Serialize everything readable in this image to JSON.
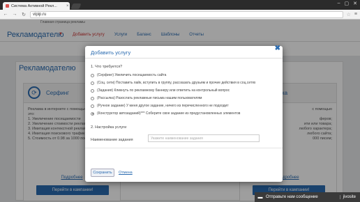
{
  "browser": {
    "tab_title": "Система Активной Рекл...",
    "tab_close": "×",
    "url": "vipip.ru",
    "back": "←",
    "forward": "→",
    "reload": "↻",
    "star": "☆",
    "menu": "≡",
    "controls": [
      "–",
      "▢",
      "✕"
    ]
  },
  "site": {
    "home_link": "Главная страница рекламы",
    "logo_title": "Рекламодателю",
    "caret": "▼",
    "nav": [
      "Добавить услугу",
      "Услуги",
      "Баланс",
      "Шаблоны",
      "Отчеты"
    ]
  },
  "panel": {
    "title": "Рекламодателю",
    "cards": [
      {
        "title": "Серфинг",
        "icon": "refresh-icon",
        "body": "Реклама в интернете с помощью\nэто:\n1. Увеличение посещаемости\n2. Увеличение стоимости рекламы\n3. Имитация контекстной реклам\n4. Имитация поискового трафика\n5. Стоимость от 0.98 за 1000 посе",
        "more": "Подробнее",
        "button": "Перейти в кампании!"
      },
      {
        "title": "Рассылка",
        "icon": "mail-icon",
        "body": "с помощью\n\nферов;\nити или товара;\nлюбого характера;\nлюбого сайта;\n000 писем;",
        "more": "Подробнее",
        "button": "Перейти в кампании!"
      }
    ]
  },
  "modal": {
    "title": "Добавить услугу",
    "close": "✖",
    "section1": "1. Что требуется?",
    "options": [
      {
        "label": "(Серфинг) Увеличить посещаемость сайта",
        "checked": false
      },
      {
        "label": "(Соц. сети) Поставить лайк, вступить в группу, рассказать друзьям и прочие действия в соц.сетях",
        "checked": false
      },
      {
        "label": "(Задания) Кликнуть по рекламному баннеру или ответить на контрольный вопрос",
        "checked": false
      },
      {
        "label": "(Рассылка) Разослать рекламные письма нашим пользователям",
        "checked": false
      },
      {
        "label": "(Ручное задание) У меня другое задание, ничего из перечисленного не подходит",
        "checked": false
      },
      {
        "label": "(Конструктор автозаданий)*** Соберите свое задание из предустановленных элементов",
        "checked": true
      }
    ],
    "section2": "2. Настройка услуги",
    "field_label": "Наименование задания",
    "field_placeholder": "Укажите наименование задания",
    "field_value": "",
    "save_label": "Сохранить",
    "cancel_label": "Отмена"
  },
  "chat": {
    "icon": "chat-icon",
    "label": "Отправьте нам сообщение",
    "brand": "jivosite"
  },
  "colors": {
    "accent": "#2a6bb0",
    "nav_active": "#cc3333",
    "page_bg": "#e7e8ea"
  }
}
